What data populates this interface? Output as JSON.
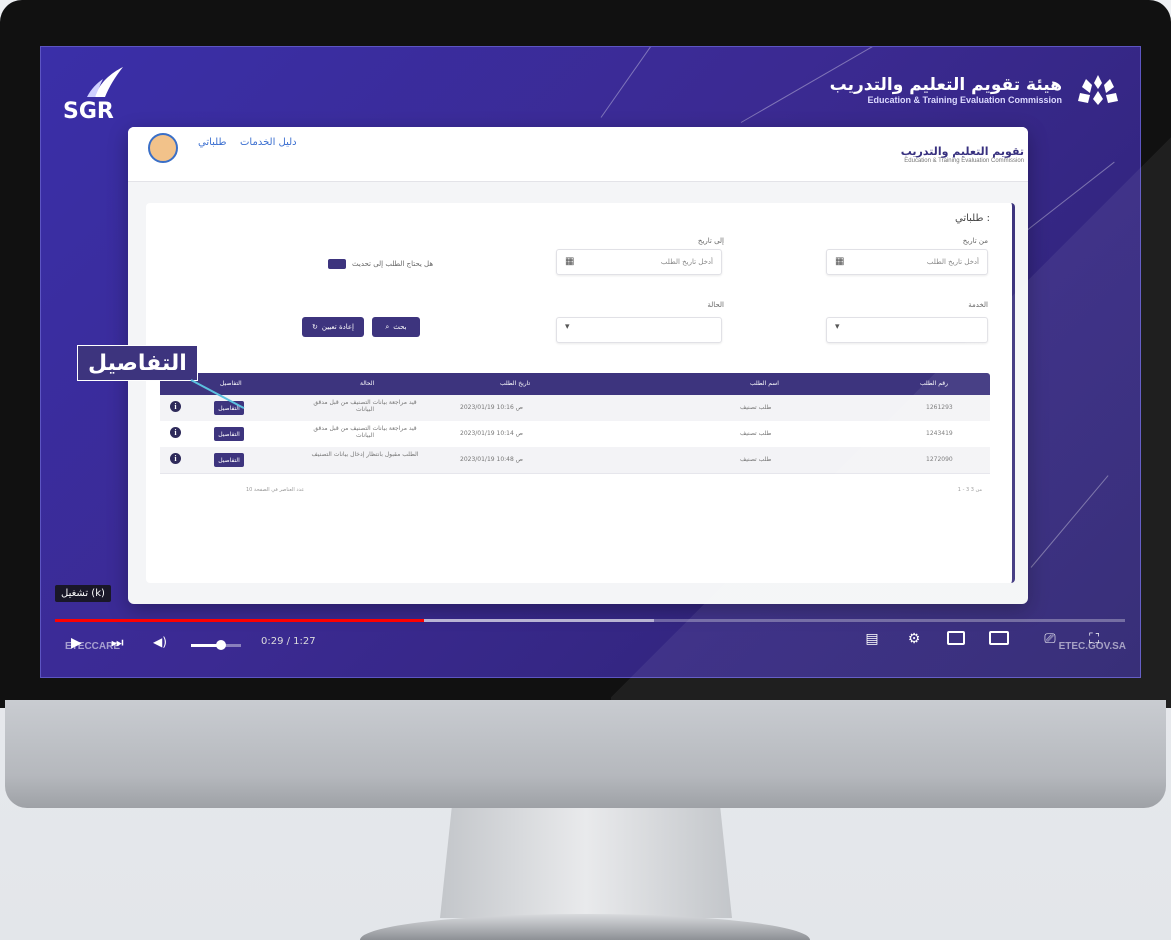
{
  "brand": {
    "sgr_logo": "SGR",
    "etec_ar": "هيئة تقويم التعليم والتدريب",
    "etec_en": "Education & Training Evaluation Commission"
  },
  "page": {
    "nav_link_services": "دليل الخدمات",
    "nav_link_requests": "طلباتي",
    "logo_ar": "تقويم التعليم والتدريب",
    "logo_en": "Education & Training Evaluation Commission",
    "panel_title": "طلباتي :",
    "filters": {
      "from_date_label": "من تاريخ",
      "from_date_placeholder": "أدخل تاريخ الطلب",
      "to_date_label": "إلى تاريخ",
      "to_date_placeholder": "أدخل تاريخ الطلب",
      "service_label": "الخدمة",
      "status_label": "الحالة",
      "toggle_label": "هل يحتاج الطلب إلى تحديث",
      "search_button": "بحث",
      "reset_button": "إعادة تعيين"
    },
    "table": {
      "headers": [
        "رقم الطلب",
        "اسم الطلب",
        "تاريخ الطلب",
        "الحالة",
        "التفاصيل"
      ],
      "rows": [
        {
          "id": "1261293",
          "name": "طلب تصنيف",
          "date": "2023/01/19 ص 10:16",
          "status": "قيد مراجعة بيانات التصنيف من قبل مدقق البيانات",
          "action": "التفاصيل"
        },
        {
          "id": "1243419",
          "name": "طلب تصنيف",
          "date": "2023/01/19 ص 10:14",
          "status": "قيد مراجعة بيانات التصنيف من قبل مدقق البيانات",
          "action": "التفاصيل"
        },
        {
          "id": "1272090",
          "name": "طلب تصنيف",
          "date": "2023/01/19 ص 10:48",
          "status": "الطلب مقبول بانتظار إدخال بيانات التصنيف",
          "action": "التفاصيل"
        }
      ],
      "footer_left": "عدد العناصر في الصفحة 10",
      "footer_right": "1 - 3 من 3"
    }
  },
  "callout": "التفاصيل",
  "player": {
    "tooltip": "تشغيل (k)",
    "time": "0:29 / 1:27",
    "progress": 0.345,
    "buffered": 0.56,
    "volume": 0.6,
    "watermark_left": "ETECCARE",
    "watermark_right": "ETEC.GOV.SA"
  }
}
